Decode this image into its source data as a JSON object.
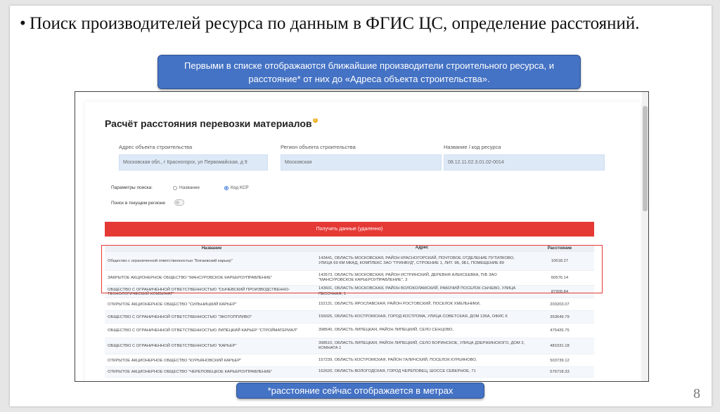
{
  "slide": {
    "heading": "Поиск производителей ресурса по данным в ФГИС ЦС, определение расстояний.",
    "bullet": "•",
    "callout_top": "Первыми в списке отображаются ближайшие производители строительного ресурса, и расстояние* от них до «Адреса объекта строительства».",
    "callout_bottom": "*расстояние сейчас отображается в метрах",
    "page_number": "8"
  },
  "form": {
    "title": "Расчёт расстояния перевозки материалов",
    "help_glyph": "?",
    "fields": [
      {
        "label": "Адрес объекта строительства",
        "value": "Московская обл., г Красногорск, ул Первомайская, д 9"
      },
      {
        "label": "Регион объекта строительства",
        "value": "Московская"
      },
      {
        "label": "Название / код ресурса",
        "value": "08.12.11.02.3.01.02-0014"
      }
    ],
    "params_label": "Параметры поиска:",
    "radio_name": "Название",
    "radio_code": "Код КСР",
    "selected_param": "Код КСР",
    "region_search_label": "Поиск в текущем регионе",
    "region_search_on": false,
    "submit_label": "Получить данные (удаленно)"
  },
  "table": {
    "headers": [
      "Название",
      "Адрес",
      "Расстояние"
    ],
    "rows": [
      {
        "name": "Общество с ограниченной ответственностью \"Богаевский карьер\"",
        "address": "143441, ОБЛАСТЬ МОСКОВСКАЯ, РАЙОН КРАСНОГОРСКИЙ, ПОЧТОВОЕ ОТДЕЛЕНИЕ ПУТИЛКОВО, УЛИЦА 69 КМ МКАД, КОМПЛЕКС ЗАО \"ГРИНВУД\", СТРОЕНИЕ 1, ЛИТ. 9Б, 9Б1, ПОМЕЩЕНИЕ 89",
        "distance": "10618.27"
      },
      {
        "name": "ЗАКРЫТОЕ АКЦИОНЕРНОЕ ОБЩЕСТВО \"МАНСУРОВСКОЕ КАРЬЕРОУПРАВЛЕНИЕ\"",
        "address": "143573, ОБЛАСТЬ МОСКОВСКАЯ, РАЙОН ИСТРИНСКИЙ, ДЕРЕВНЯ АЛЕКСЕЕВКА, П/Б ЗАО \"МАНСУРОВСКОЕ КАРЬЕРОУПРАВЛЕНИЕ\", 3",
        "distance": "60576.14"
      },
      {
        "name": "ОБЩЕСТВО С ОГРАНИЧЕННОЙ ОТВЕТСТВЕННОСТЬЮ \"СЫЧЕВСКИЙ ПРОИЗВОДСТВЕННО-ТЕХНОЛОГИЧЕСКИЙ КОМБИНАТ\"",
        "address": "143601, ОБЛАСТЬ МОСКОВСКАЯ, РАЙОН ВОЛОКОЛАМСКИЙ, РАБОЧИЙ ПОСЕЛОК СЫЧЕВО, УЛИЦА ПЕСОЧНАЯ, 1",
        "distance": "87909.84"
      },
      {
        "name": "ОТКРЫТОЕ АКЦИОНЕРНОЕ ОБЩЕСТВО \"СИЛЬНИЦКИЙ КАРЬЕР\"",
        "address": "152131, ОБЛАСТЬ ЯРОСЛАВСКАЯ, РАЙОН РОСТОВСКИЙ, ПОСЕЛОК ХМЕЛЬНИКИ,",
        "distance": "203203.07"
      },
      {
        "name": "ОБЩЕСТВО С ОГРАНИЧЕННОЙ ОТВЕТСТВЕННОСТЬЮ \"ЭКОТОППЛИВО\"",
        "address": "156026, ОБЛАСТЬ КОСТРОМСКАЯ, ГОРОД КОСТРОМА, УЛИЦА СОВЕТСКАЯ, ДОМ 136А, ОФИС 6",
        "distance": "353649.79"
      },
      {
        "name": "ОБЩЕСТВО С ОГРАНИЧЕННОЙ ОТВЕТСТВЕННОСТЬЮ ЛИПЕЦКИЙ КАРЬЕР \"СТРОЙМАТЕРИАЛ\"",
        "address": "398540, ОБЛАСТЬ ЛИПЕЦКАЯ, РАЙОН ЛИПЕЦКИЙ, СЕЛО СЕНЦОВО,",
        "distance": "475426.75"
      },
      {
        "name": "ОБЩЕСТВО С ОГРАНИЧЕННОЙ ОТВЕТСТВЕННОСТЬЮ \"КАРЬЕР\"",
        "address": "398510, ОБЛАСТЬ ЛИПЕЦКАЯ, РАЙОН ЛИПЕЦКИЙ, СЕЛО БОРИНСКОЕ, УЛИЦА ДЗЕРЖИНСКОГО, ДОМ 2, КОМНАТА 1",
        "distance": "481031.18"
      },
      {
        "name": "ОТКРЫТОЕ АКЦИОНЕРНОЕ ОБЩЕСТВО \"КУРЬЯНОВСКИЙ КАРЬЕР\"",
        "address": "157239, ОБЛАСТЬ КОСТРОМСКАЯ, РАЙОН ГАЛИЧСКИЙ, ПОСЕЛОК КУРЬЯНОВО,",
        "distance": "503739.12"
      },
      {
        "name": "ОТКРЫТОЕ АКЦИОНЕРНОЕ ОБЩЕСТВО \"ЧЕРЕПОВЕЦКОЕ КАРЬЕРОУПРАВЛЕНИЕ\"",
        "address": "162620, ОБЛАСТЬ ВОЛОГОДСКАЯ, ГОРОД ЧЕРЕПОВЕЦ, ШОССЕ СЕВЕРНОЕ, 71",
        "distance": "576718.33"
      }
    ]
  }
}
